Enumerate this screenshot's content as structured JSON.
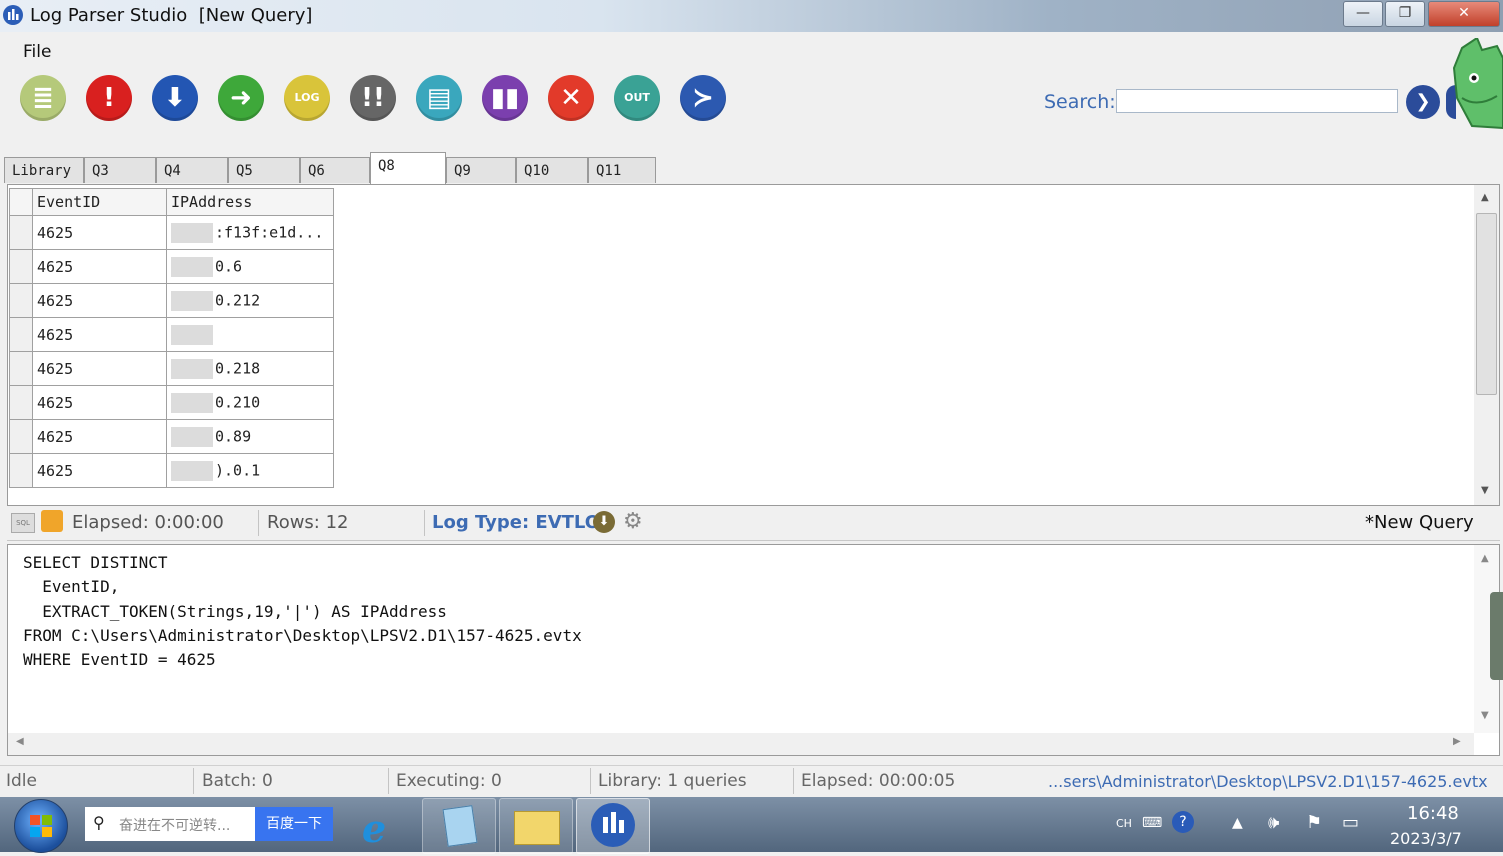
{
  "window": {
    "title": "Log Parser Studio",
    "subtitle": "[New Query]",
    "minimize_label": "—",
    "maximize_label": "❐",
    "close_label": "✕"
  },
  "menu": {
    "file_label": "File"
  },
  "toolbar": {
    "buttons": [
      {
        "name": "new-query",
        "glyph": "≣",
        "color": "#b5c97a"
      },
      {
        "name": "alert",
        "glyph": "!",
        "color": "#d9201f"
      },
      {
        "name": "download",
        "glyph": "⬇",
        "color": "#2356b3"
      },
      {
        "name": "run",
        "glyph": "➜",
        "color": "#3ea83a"
      },
      {
        "name": "log",
        "glyph": "LOG",
        "color": "#d9c43a"
      },
      {
        "name": "double-alert",
        "glyph": "!!",
        "color": "#666666"
      },
      {
        "name": "document",
        "glyph": "▤",
        "color": "#3aa7bd"
      },
      {
        "name": "chart",
        "glyph": "▮▮",
        "color": "#7b3fae"
      },
      {
        "name": "cancel",
        "glyph": "✕",
        "color": "#e23a2a"
      },
      {
        "name": "out",
        "glyph": "OUT",
        "color": "#3aa295"
      },
      {
        "name": "powershell",
        "glyph": "≻",
        "color": "#2c59b0"
      }
    ],
    "search_label": "Search:",
    "search_value": ""
  },
  "tabs": [
    {
      "label": "Library",
      "active": false
    },
    {
      "label": "Q3",
      "active": false
    },
    {
      "label": "Q4",
      "active": false
    },
    {
      "label": "Q5",
      "active": false
    },
    {
      "label": "Q6",
      "active": false
    },
    {
      "label": "Q8",
      "active": true
    },
    {
      "label": "Q9",
      "active": false
    },
    {
      "label": "Q10",
      "active": false
    },
    {
      "label": "Q11",
      "active": false
    }
  ],
  "grid": {
    "columns": [
      "EventID",
      "IPAddress"
    ],
    "rows": [
      {
        "event_id": "4625",
        "ip": ":f13f:e1d..."
      },
      {
        "event_id": "4625",
        "ip": "0.6"
      },
      {
        "event_id": "4625",
        "ip": "0.212"
      },
      {
        "event_id": "4625",
        "ip": ""
      },
      {
        "event_id": "4625",
        "ip": "0.218"
      },
      {
        "event_id": "4625",
        "ip": "0.210"
      },
      {
        "event_id": "4625",
        "ip": "0.89"
      },
      {
        "event_id": "4625",
        "ip": ").0.1"
      }
    ]
  },
  "query_status": {
    "elapsed": "Elapsed: 0:00:00",
    "rows": "Rows: 12",
    "log_type": "Log Type: EVTLOG",
    "query_name": "*New Query"
  },
  "query_text": "SELECT DISTINCT\n  EventID,\n  EXTRACT_TOKEN(Strings,19,'|') AS IPAddress\nFROM C:\\Users\\Administrator\\Desktop\\LPSV2.D1\\157-4625.evtx\nWHERE EventID = 4625",
  "statusbar": {
    "state": "Idle",
    "batch": "Batch: 0",
    "executing": "Executing: 0",
    "library": "Library: 1 queries",
    "elapsed": "Elapsed: 00:00:05",
    "path": "...sers\\Administrator\\Desktop\\LPSV2.D1\\157-4625.evtx"
  },
  "taskbar": {
    "search_placeholder": "奋进在不可逆转...",
    "search_button": "百度一下",
    "lang": "CH",
    "time": "16:48",
    "date": "2023/3/7"
  }
}
